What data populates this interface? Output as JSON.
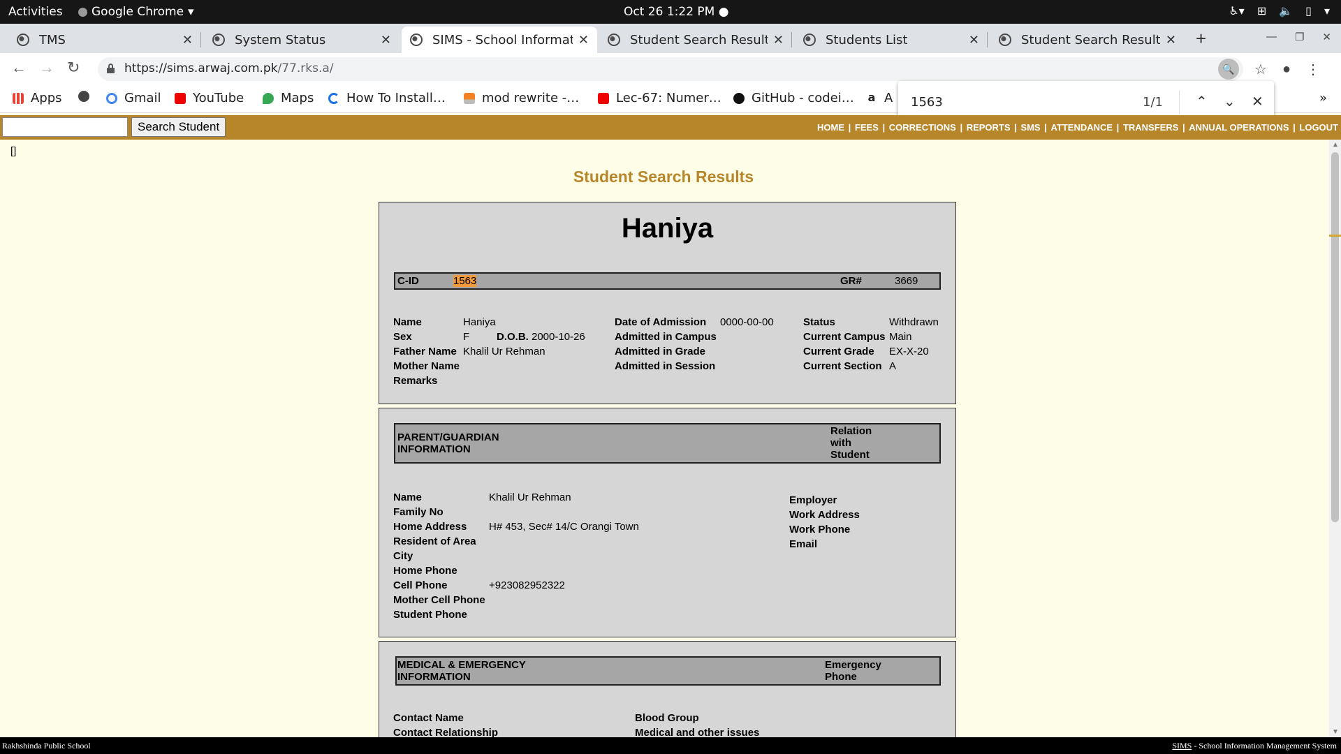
{
  "os": {
    "activities": "Activities",
    "app": "Google Chrome",
    "clock": "Oct 26  1:22 PM"
  },
  "tabs": [
    {
      "title": "TMS"
    },
    {
      "title": "System Status"
    },
    {
      "title": "SIMS - School Informati"
    },
    {
      "title": "Student Search Results"
    },
    {
      "title": "Students List"
    },
    {
      "title": "Student Search Results"
    }
  ],
  "address": {
    "domain": "https://sims.arwaj.com.pk",
    "path": "/77.rks.a/"
  },
  "bookmarks": [
    {
      "label": "Apps",
      "icon": "apps-grid-icon"
    },
    {
      "label": "",
      "icon": "globe-icon"
    },
    {
      "label": "Gmail",
      "icon": "google-icon"
    },
    {
      "label": "YouTube",
      "icon": "youtube-icon"
    },
    {
      "label": "Maps",
      "icon": "maps-pin-icon"
    },
    {
      "label": "How To Install…",
      "icon": "loading-icon"
    },
    {
      "label": "mod rewrite -…",
      "icon": "stackoverflow-icon"
    },
    {
      "label": "Lec-67: Numer…",
      "icon": "youtube-icon"
    },
    {
      "label": "GitHub - codei…",
      "icon": "github-icon"
    },
    {
      "label": "A",
      "icon": "amazon-icon"
    }
  ],
  "find": {
    "query": "1563",
    "count": "1/1"
  },
  "sitenav": {
    "search_button": "Search Student",
    "menu": [
      "HOME",
      "FEES",
      "CORRECTIONS",
      "REPORTS",
      "SMS",
      "ATTENDANCE",
      "TRANSFERS",
      "ANNUAL OPERATIONS",
      "LOGOUT"
    ]
  },
  "page": {
    "bracket": "[]",
    "title": "Student Search Results"
  },
  "student": {
    "name": "Haniya",
    "cid_label": "C-ID",
    "cid": "1563",
    "gr_label": "GR#",
    "gr": "3669",
    "labels": {
      "name": "Name",
      "sex": "Sex",
      "dob": "D.O.B.",
      "father": "Father Name",
      "mother": "Mother Name",
      "remarks": "Remarks",
      "doa": "Date of Admission",
      "adm_campus": "Admitted in Campus",
      "adm_grade": "Admitted in Grade",
      "adm_session": "Admitted in Session",
      "status": "Status",
      "cur_campus": "Current Campus",
      "cur_grade": "Current Grade",
      "cur_section": "Current Section"
    },
    "values": {
      "name": "Haniya",
      "sex": "F",
      "dob": "2000-10-26",
      "father": "Khalil Ur Rehman",
      "doa": "0000-00-00",
      "status": "Withdrawn",
      "cur_campus": "Main",
      "cur_grade": "EX-X-20",
      "cur_section": "A"
    }
  },
  "guardian": {
    "header_left": [
      "PARENT/GUARDIAN",
      "INFORMATION"
    ],
    "header_right": [
      "Relation",
      "with",
      "Student"
    ],
    "labels": {
      "name": "Name",
      "family": "Family No",
      "home_address": "Home Address",
      "resident": "Resident of Area",
      "city": "City",
      "home_phone": "Home Phone",
      "cell": "Cell Phone",
      "mother_cell": "Mother Cell Phone",
      "student_phone": "Student Phone",
      "employer": "Employer",
      "work_address": "Work Address",
      "work_phone": "Work Phone",
      "email": "Email"
    },
    "values": {
      "name": "Khalil Ur Rehman",
      "home_address": "H# 453, Sec# 14/C Orangi Town",
      "cell": "+923082952322"
    }
  },
  "medical": {
    "header_left": [
      "MEDICAL & EMERGENCY",
      "INFORMATION"
    ],
    "header_right": [
      "Emergency",
      "Phone"
    ],
    "labels": {
      "contact_name": "Contact Name",
      "contact_rel": "Contact Relationship",
      "blood": "Blood Group",
      "issues": "Medical and other issues"
    }
  },
  "status": {
    "left": "Rakhshinda Public School",
    "right_link": "SIMS",
    "right_text": " - School Information Management System"
  },
  "colors": {
    "brand": "#b8862a",
    "page_bg": "#fefee8",
    "highlight": "#f29a3c"
  }
}
